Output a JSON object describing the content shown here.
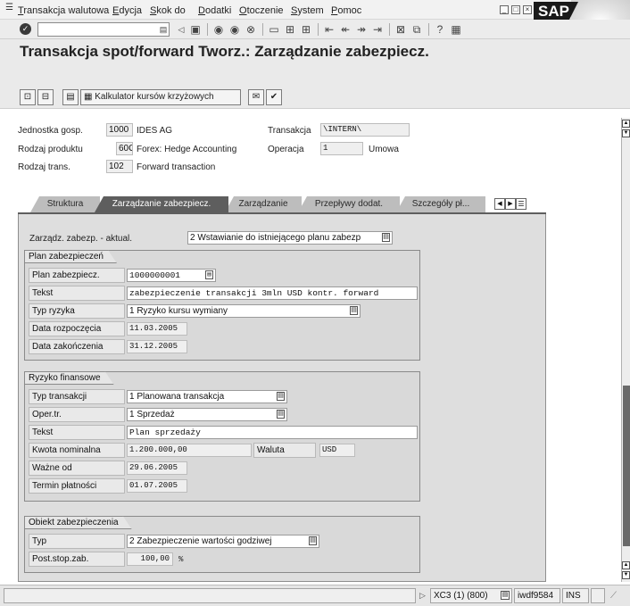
{
  "menu": {
    "items": [
      {
        "label": "Transakcja walutowa"
      },
      {
        "label": "Edycja"
      },
      {
        "label": "Skok do"
      },
      {
        "label": "Dodatki"
      },
      {
        "label": "Otoczenie"
      },
      {
        "label": "System"
      },
      {
        "label": "Pomoc"
      }
    ],
    "logo": "SAP"
  },
  "title": "Transakcja spot/forward Tworz.: Zarządzanie zabezpiecz.",
  "app_toolbar": {
    "calc_button": "Kalkulator kursów krzyżowych"
  },
  "header": {
    "company_code": {
      "label": "Jednostka gosp.",
      "code": "1000",
      "text": "IDES AG"
    },
    "product_type": {
      "label": "Rodzaj produktu",
      "code": "60C",
      "text": "Forex: Hedge Accounting"
    },
    "trans_type": {
      "label": "Rodzaj trans.",
      "code": "102",
      "text": "Forward transaction"
    },
    "transaction": {
      "label": "Transakcja",
      "value": "\\INTERN\\"
    },
    "operation": {
      "label": "Operacja",
      "value": "1",
      "text": "Umowa"
    }
  },
  "tabs": [
    {
      "label": "Struktura",
      "active": false
    },
    {
      "label": "Zarządzanie zabezpiecz.",
      "active": true
    },
    {
      "label": "Zarządzanie",
      "active": false
    },
    {
      "label": "Przepływy dodat.",
      "active": false
    },
    {
      "label": "Szczegóły pł...",
      "active": false
    }
  ],
  "panel": {
    "update_label": "Zarządz. zabezp. - aktual.",
    "update_value": "2 Wstawianie do istniejącego planu zabezp",
    "plan_group": {
      "title": "Plan zabezpieczeń",
      "plan_label": "Plan zabezpiecz.",
      "plan_value": "1000000001",
      "text_label": "Tekst",
      "text_value": "zabezpieczenie transakcji 3mln USD kontr. forward",
      "risk_label": "Typ ryzyka",
      "risk_value": "1 Ryzyko kursu wymiany",
      "start_label": "Data rozpoczęcia",
      "start_value": "11.03.2005",
      "end_label": "Data zakończenia",
      "end_value": "31.12.2005"
    },
    "risk_group": {
      "title": "Ryzyko finansowe",
      "tt_label": "Typ transakcji",
      "tt_value": "1 Planowana transakcja",
      "op_label": "Oper.tr.",
      "op_value": "1 Sprzedaż",
      "text_label": "Tekst",
      "text_value": "Plan sprzedaży",
      "nominal_label": "Kwota nominalna",
      "nominal_value": "1.200.000,00",
      "currency_label": "Waluta",
      "currency_value": "USD",
      "valid_label": "Ważne od",
      "valid_value": "29.06.2005",
      "due_label": "Termin płatności",
      "due_value": "01.07.2005"
    },
    "object_group": {
      "title": "Obiekt zabezpieczenia",
      "type_label": "Typ",
      "type_value": "2 Zabezpieczenie wartości godziwej",
      "post_label": "Post.stop.zab.",
      "post_value": "100,00",
      "post_unit": "%"
    }
  },
  "status_bar": {
    "system": "XC3 (1) (800)",
    "server": "iwdf9584",
    "mode": "INS"
  }
}
